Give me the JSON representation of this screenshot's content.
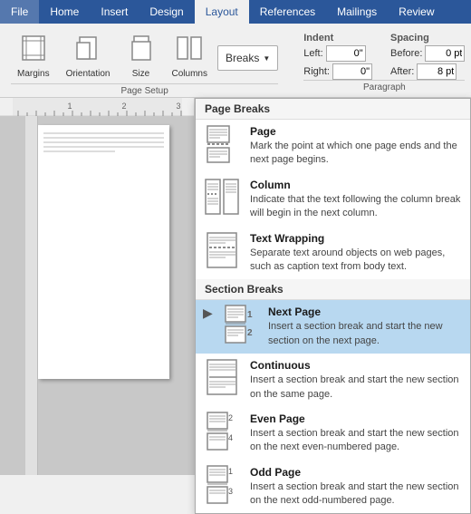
{
  "tabs": [
    {
      "label": "File",
      "active": false
    },
    {
      "label": "Home",
      "active": false
    },
    {
      "label": "Insert",
      "active": false
    },
    {
      "label": "Design",
      "active": false
    },
    {
      "label": "Layout",
      "active": true
    },
    {
      "label": "References",
      "active": false
    },
    {
      "label": "Mailings",
      "active": false
    },
    {
      "label": "Review",
      "active": false
    }
  ],
  "toolbar": {
    "page_setup_label": "Page Setup",
    "margins_label": "Margins",
    "orientation_label": "Orientation",
    "size_label": "Size",
    "columns_label": "Columns",
    "breaks_label": "Breaks",
    "indent_label": "Indent",
    "spacing_label": "Spacing"
  },
  "breaks_dropdown": {
    "page_breaks_header": "Page Breaks",
    "section_breaks_header": "Section Breaks",
    "items": [
      {
        "id": "page",
        "title": "Page",
        "desc": "Mark the point at which one page ends and the next page begins.",
        "selected": false
      },
      {
        "id": "column",
        "title": "Column",
        "desc": "Indicate that the text following the column break will begin in the next column.",
        "selected": false
      },
      {
        "id": "text-wrapping",
        "title": "Text Wrapping",
        "desc": "Separate text around objects on web pages, such as caption text from body text.",
        "selected": false
      },
      {
        "id": "next-page",
        "title": "Next Page",
        "desc": "Insert a section break and start the new section on the next page.",
        "selected": true
      },
      {
        "id": "continuous",
        "title": "Continuous",
        "desc": "Insert a section break and start the new section on the same page.",
        "selected": false
      },
      {
        "id": "even-page",
        "title": "Even Page",
        "desc": "Insert a section break and start the new section on the next even-numbered page.",
        "selected": false
      },
      {
        "id": "odd-page",
        "title": "Odd Page",
        "desc": "Insert a section break and start the new section on the next odd-numbered page.",
        "selected": false
      }
    ]
  }
}
